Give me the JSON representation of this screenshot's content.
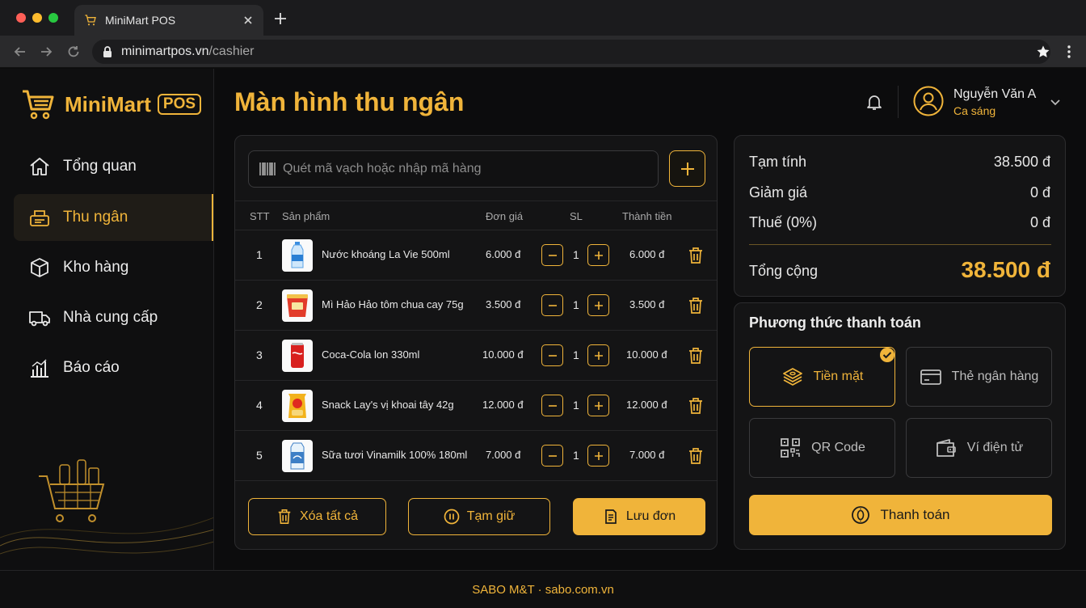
{
  "browser": {
    "tab_title": "MiniMart POS",
    "url_domain": "minimartpos.vn",
    "url_path": "/cashier"
  },
  "app": {
    "logo_name": "MiniMart",
    "logo_badge": "POS"
  },
  "sidebar": {
    "items": [
      {
        "label": "Tổng quan",
        "icon": "home-icon",
        "active": false
      },
      {
        "label": "Thu ngân",
        "icon": "cash-register-icon",
        "active": true
      },
      {
        "label": "Kho hàng",
        "icon": "box-icon",
        "active": false
      },
      {
        "label": "Nhà cung cấp",
        "icon": "truck-icon",
        "active": false
      },
      {
        "label": "Báo cáo",
        "icon": "bar-chart-icon",
        "active": false
      }
    ]
  },
  "header": {
    "page_title": "Màn hình thu ngân",
    "user_name": "Nguyễn Văn A",
    "user_shift": "Ca sáng"
  },
  "search": {
    "placeholder": "Quét mã vạch hoặc nhập mã hàng"
  },
  "cart": {
    "columns": {
      "index": "STT",
      "product": "Sản phẩm",
      "unit_price": "Đơn giá",
      "qty": "SL",
      "amount": "Thành tiền"
    },
    "rows": [
      {
        "index": "1",
        "name": "Nước khoáng La Vie 500ml",
        "price": "6.000 đ",
        "qty": "1",
        "amount": "6.000 đ",
        "thumb": "water-bottle-icon"
      },
      {
        "index": "2",
        "name": "Mì Hảo Hảo tôm chua cay 75g",
        "price": "3.500 đ",
        "qty": "1",
        "amount": "3.500 đ",
        "thumb": "noodle-cup-icon"
      },
      {
        "index": "3",
        "name": "Coca-Cola lon 330ml",
        "price": "10.000 đ",
        "qty": "1",
        "amount": "10.000 đ",
        "thumb": "soda-can-icon"
      },
      {
        "index": "4",
        "name": "Snack Lay's vị khoai tây 42g",
        "price": "12.000 đ",
        "qty": "1",
        "amount": "12.000 đ",
        "thumb": "snack-bag-icon"
      },
      {
        "index": "5",
        "name": "Sữa tươi Vinamilk 100% 180ml",
        "price": "7.000 đ",
        "qty": "1",
        "amount": "7.000 đ",
        "thumb": "milk-carton-icon"
      }
    ],
    "actions": {
      "clear_all": "Xóa tất cả",
      "hold": "Tạm giữ",
      "save": "Lưu đơn"
    }
  },
  "summary": {
    "subtotal_label": "Tạm tính",
    "subtotal": "38.500 đ",
    "discount_label": "Giảm giá",
    "discount": "0 đ",
    "tax_label": "Thuế (0%)",
    "tax": "0 đ",
    "total_label": "Tổng cộng",
    "total": "38.500 đ"
  },
  "payment": {
    "title": "Phương thức thanh toán",
    "methods": [
      {
        "label": "Tiền mặt",
        "icon": "cash-stack-icon",
        "selected": true
      },
      {
        "label": "Thẻ ngân hàng",
        "icon": "bank-card-icon",
        "selected": false
      },
      {
        "label": "QR Code",
        "icon": "qr-code-icon",
        "selected": false
      },
      {
        "label": "Ví điện tử",
        "icon": "wallet-icon",
        "selected": false
      }
    ],
    "checkout_label": "Thanh toán"
  },
  "footer": {
    "text": "SABO M&T · sabo.com.vn"
  },
  "colors": {
    "accent": "#f0b43a",
    "background": "#0c0c0d",
    "panel": "#141415"
  }
}
